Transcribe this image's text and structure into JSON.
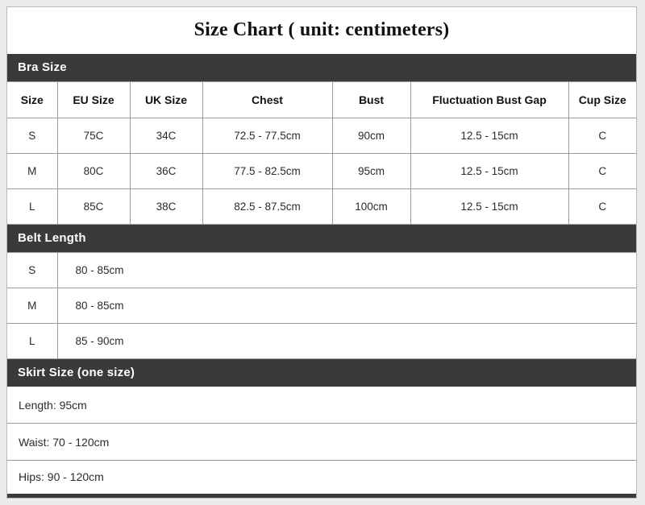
{
  "title": "Size Chart ( unit: centimeters)",
  "colors": {
    "section_bar_bg": "#3a3a3a",
    "section_bar_text": "#ffffff",
    "grid_line": "#9a9a9a",
    "page_bg": "#ebebeb",
    "table_bg": "#ffffff",
    "text": "#2b2b2b"
  },
  "sections": {
    "bra": {
      "heading": "Bra Size",
      "columns": [
        "Size",
        "EU Size",
        "UK Size",
        "Chest",
        "Bust",
        "Fluctuation Bust Gap",
        "Cup Size"
      ],
      "rows": [
        {
          "size": "S",
          "eu_size": "75C",
          "uk_size": "34C",
          "chest": "72.5 - 77.5cm",
          "bust": "90cm",
          "fluctuation_bust_gap": "12.5 - 15cm",
          "cup_size": "C"
        },
        {
          "size": "M",
          "eu_size": "80C",
          "uk_size": "36C",
          "chest": "77.5 - 82.5cm",
          "bust": "95cm",
          "fluctuation_bust_gap": "12.5 - 15cm",
          "cup_size": "C"
        },
        {
          "size": "L",
          "eu_size": "85C",
          "uk_size": "38C",
          "chest": "82.5 - 87.5cm",
          "bust": "100cm",
          "fluctuation_bust_gap": "12.5 - 15cm",
          "cup_size": "C"
        }
      ]
    },
    "belt": {
      "heading": "Belt Length",
      "rows": [
        {
          "size": "S",
          "length": "80 - 85cm"
        },
        {
          "size": "M",
          "length": "80 - 85cm"
        },
        {
          "size": "L",
          "length": "85 - 90cm"
        }
      ]
    },
    "skirt": {
      "heading": "Skirt Size (one size)",
      "rows": [
        "Length: 95cm",
        "Waist: 70 - 120cm",
        "Hips: 90 - 120cm"
      ]
    },
    "footer_bar": {
      "heading": ""
    }
  }
}
